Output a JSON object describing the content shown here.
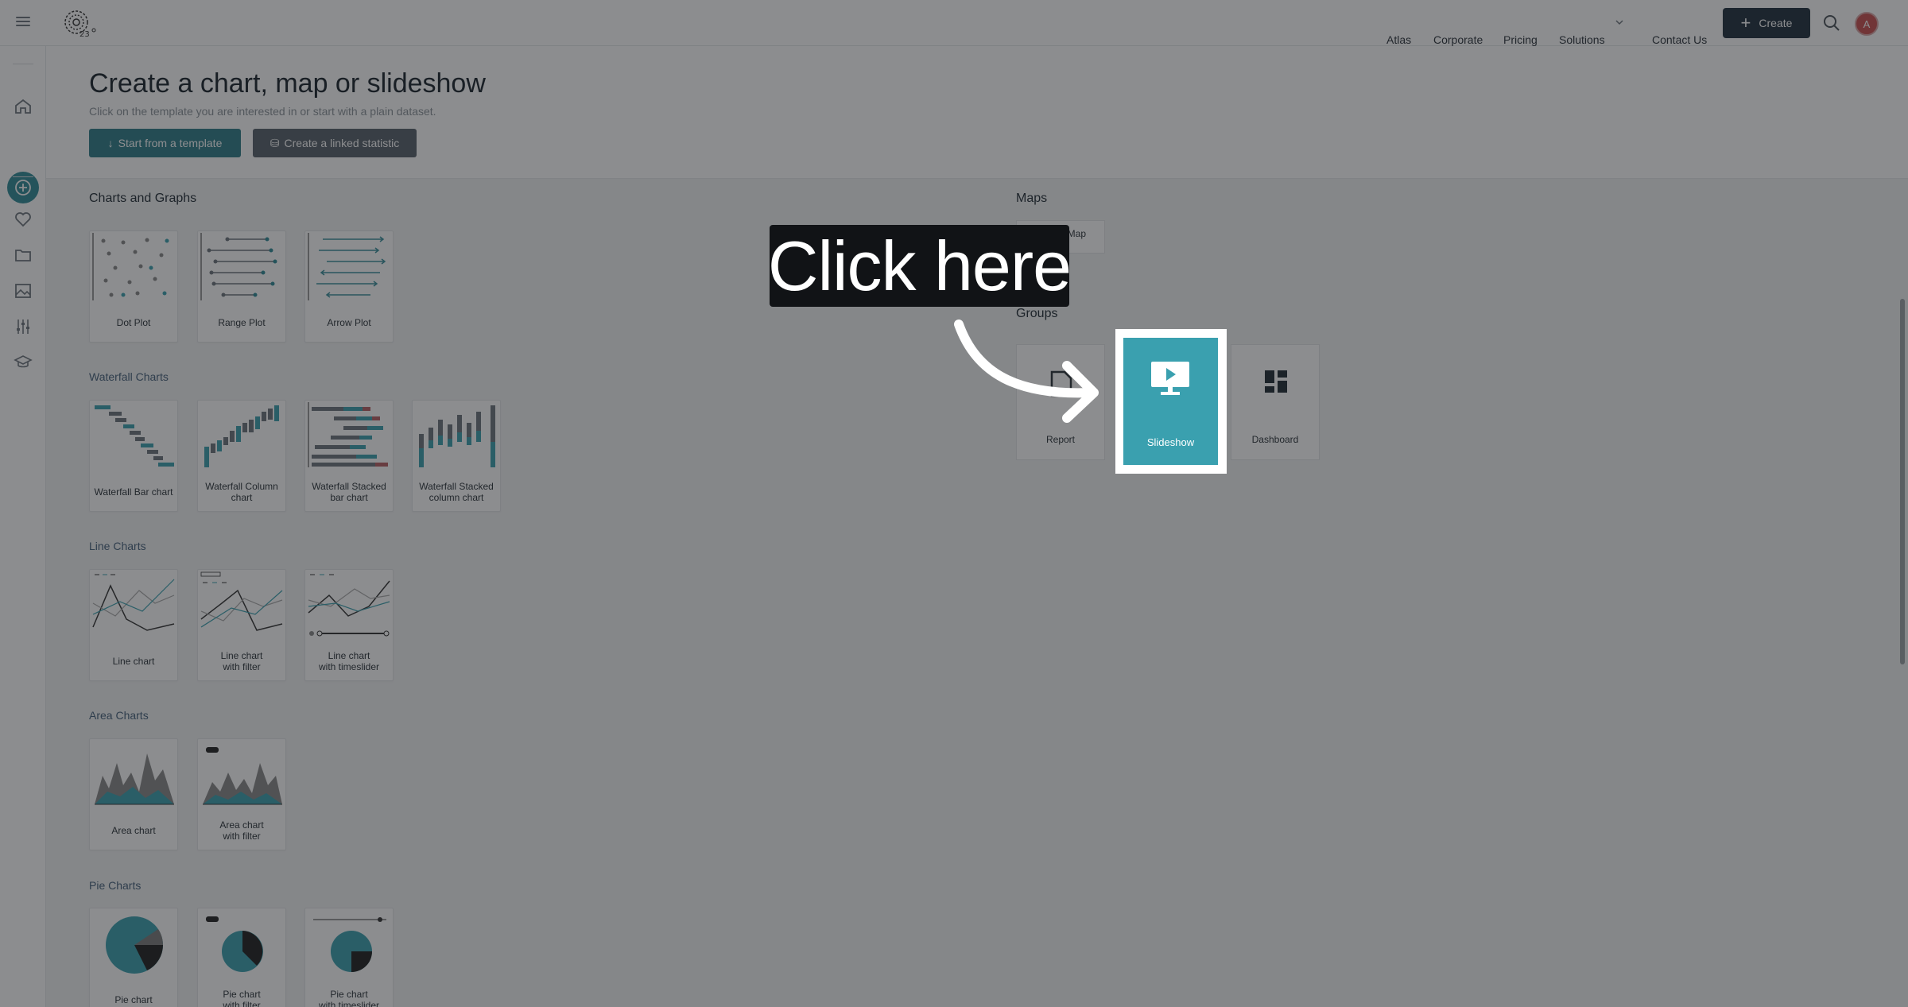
{
  "header": {
    "nav": [
      "Atlas",
      "Corporate",
      "Pricing",
      "Solutions",
      "Contact Us"
    ],
    "create_label": "Create",
    "avatar_initial": "A"
  },
  "hero": {
    "title": "Create a chart, map or slideshow",
    "subtitle": "Click on the template you are interested in or start with a plain dataset.",
    "template_button": "Start from a template",
    "linked_button": "Create a linked statistic"
  },
  "sections": {
    "charts_graphs": "Charts and Graphs",
    "waterfall": "Waterfall Charts",
    "line": "Line Charts",
    "area": "Area Charts",
    "pie": "Pie Charts",
    "maps": "Maps",
    "groups": "Groups"
  },
  "cards": {
    "dot_plot": "Dot Plot",
    "range_plot": "Range Plot",
    "arrow_plot": "Arrow Plot",
    "wf_bar": "Waterfall Bar chart",
    "wf_column_1": "Waterfall Column",
    "wf_column_2": "chart",
    "wf_stacked_bar_1": "Waterfall Stacked",
    "wf_stacked_bar_2": "bar chart",
    "wf_stacked_col_1": "Waterfall Stacked",
    "wf_stacked_col_2": "column chart",
    "line_chart": "Line chart",
    "line_filter_1": "Line chart",
    "line_filter_2": "with filter",
    "line_slider_1": "Line chart",
    "line_slider_2": "with timeslider",
    "area_chart": "Area chart",
    "area_filter_1": "Area chart",
    "area_filter_2": "with filter",
    "pie_chart": "Pie chart",
    "pie_filter_1": "Pie chart",
    "pie_filter_2": "with filter",
    "pie_slider_1": "Pie chart",
    "pie_slider_2": "with timeslider",
    "marker_map": "Marker Map",
    "report": "Report",
    "slideshow": "Slideshow",
    "dashboard": "Dashboard"
  },
  "overlay": {
    "callout": "Click here"
  },
  "colors": {
    "accent": "#2f7d89",
    "slideshow_card": "#3aa0af",
    "create_button": "#1e2e3c"
  }
}
